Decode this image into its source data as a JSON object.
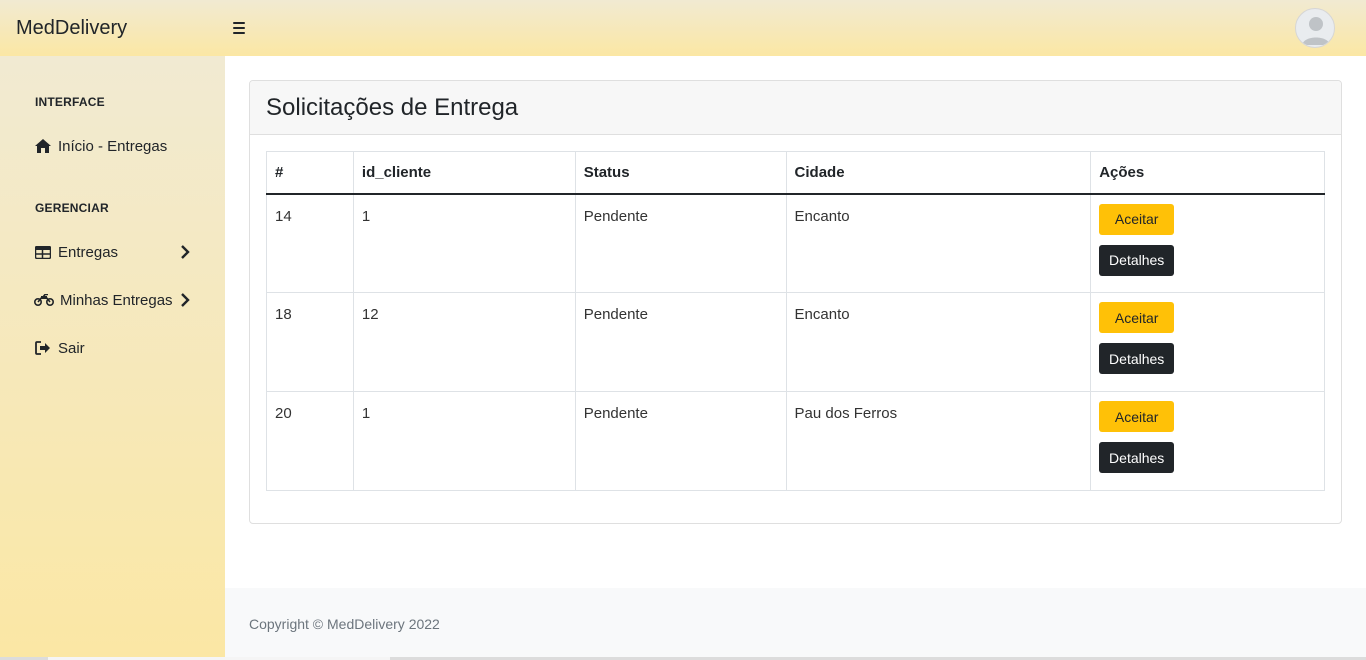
{
  "brand": "MedDelivery",
  "icons": {
    "menu": "hamburger-icon",
    "avatar": "user-avatar-icon",
    "home": "home-icon",
    "table": "table-icon",
    "motorcycle": "motorcycle-icon",
    "logout": "sign-out-icon",
    "chevron": "chevron-right-icon"
  },
  "sidebar": {
    "heading_interface": "INTERFACE",
    "heading_manage": "GERENCIAR",
    "items": [
      {
        "label": "Início - Entregas"
      },
      {
        "label": "Entregas"
      },
      {
        "label": "Minhas Entregas"
      },
      {
        "label": "Sair"
      }
    ]
  },
  "card": {
    "title": "Solicitações de Entrega"
  },
  "table": {
    "headers": [
      "#",
      "id_cliente",
      "Status",
      "Cidade",
      "Ações"
    ],
    "rows": [
      {
        "id": "14",
        "id_cliente": "1",
        "status": "Pendente",
        "cidade": "Encanto"
      },
      {
        "id": "18",
        "id_cliente": "12",
        "status": "Pendente",
        "cidade": "Encanto"
      },
      {
        "id": "20",
        "id_cliente": "1",
        "status": "Pendente",
        "cidade": "Pau dos Ferros"
      }
    ],
    "accept_label": "Aceitar",
    "details_label": "Detalhes"
  },
  "footer": {
    "text": "Copyright © MedDelivery 2022"
  },
  "colors": {
    "accent_yellow": "#ffc107",
    "dark": "#212529",
    "sidebar_top": "#f1ead2",
    "sidebar_bottom": "#fbe7a4"
  }
}
